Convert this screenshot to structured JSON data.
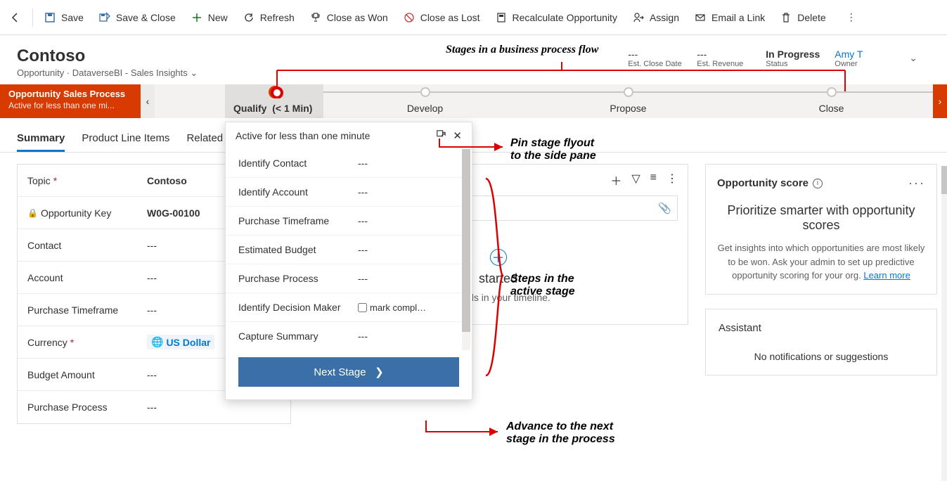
{
  "commandbar": {
    "back": "←",
    "save": "Save",
    "saveclose": "Save & Close",
    "new": "New",
    "refresh": "Refresh",
    "closewon": "Close as Won",
    "closelost": "Close as Lost",
    "recalc": "Recalculate Opportunity",
    "assign": "Assign",
    "emaillink": "Email a Link",
    "delete": "Delete"
  },
  "header": {
    "title": "Contoso",
    "subtitle": "Opportunity · DataverseBI - Sales Insights",
    "meta": {
      "closedate_val": "---",
      "closedate_lbl": "Est. Close Date",
      "revenue_val": "---",
      "revenue_lbl": "Est. Revenue",
      "status_val": "In Progress",
      "status_lbl": "Status",
      "owner_val": "Amy T",
      "owner_lbl": "Owner"
    }
  },
  "bpf": {
    "title": "Opportunity Sales Process",
    "subtitle": "Active for less than one mi...",
    "stages": {
      "qualify": "Qualify",
      "qualify_time": "(< 1 Min)",
      "develop": "Develop",
      "propose": "Propose",
      "close": "Close"
    }
  },
  "tabs": {
    "summary": "Summary",
    "productline": "Product Line Items",
    "related": "Related"
  },
  "form": {
    "topic_lbl": "Topic",
    "topic_val": "Contoso",
    "key_lbl": "Opportunity Key",
    "key_val": "W0G-00100",
    "contact_lbl": "Contact",
    "contact_val": "---",
    "account_lbl": "Account",
    "account_val": "---",
    "timeframe_lbl": "Purchase Timeframe",
    "timeframe_val": "---",
    "currency_lbl": "Currency",
    "currency_val": "US Dollar",
    "budget_lbl": "Budget Amount",
    "budget_val": "---",
    "process_lbl": "Purchase Process",
    "process_val": "---"
  },
  "timeline": {
    "started": "started",
    "empty1": "records in your timeline."
  },
  "score": {
    "title": "Opportunity score",
    "head": "Prioritize smarter with opportunity scores",
    "body": "Get insights into which opportunities are most likely to be won. Ask your admin to set up predictive opportunity scoring for your org.",
    "link": "Learn more"
  },
  "assistant": {
    "title": "Assistant",
    "body": "No notifications or suggestions"
  },
  "flyout": {
    "head": "Active for less than one minute",
    "steps": {
      "contact": "Identify Contact",
      "account": "Identify Account",
      "timeframe": "Purchase Timeframe",
      "budget": "Estimated Budget",
      "process": "Purchase Process",
      "decision": "Identify Decision Maker",
      "summary": "Capture Summary",
      "dash": "---",
      "mark": "mark compl…"
    },
    "next": "Next Stage"
  },
  "annot": {
    "stages": "Stages in a business process flow",
    "pin1": "Pin stage flyout",
    "pin2": "to the side pane",
    "steps1": "Steps in the",
    "steps2": "active stage",
    "adv1": "Advance to the next",
    "adv2": "stage in the process"
  }
}
